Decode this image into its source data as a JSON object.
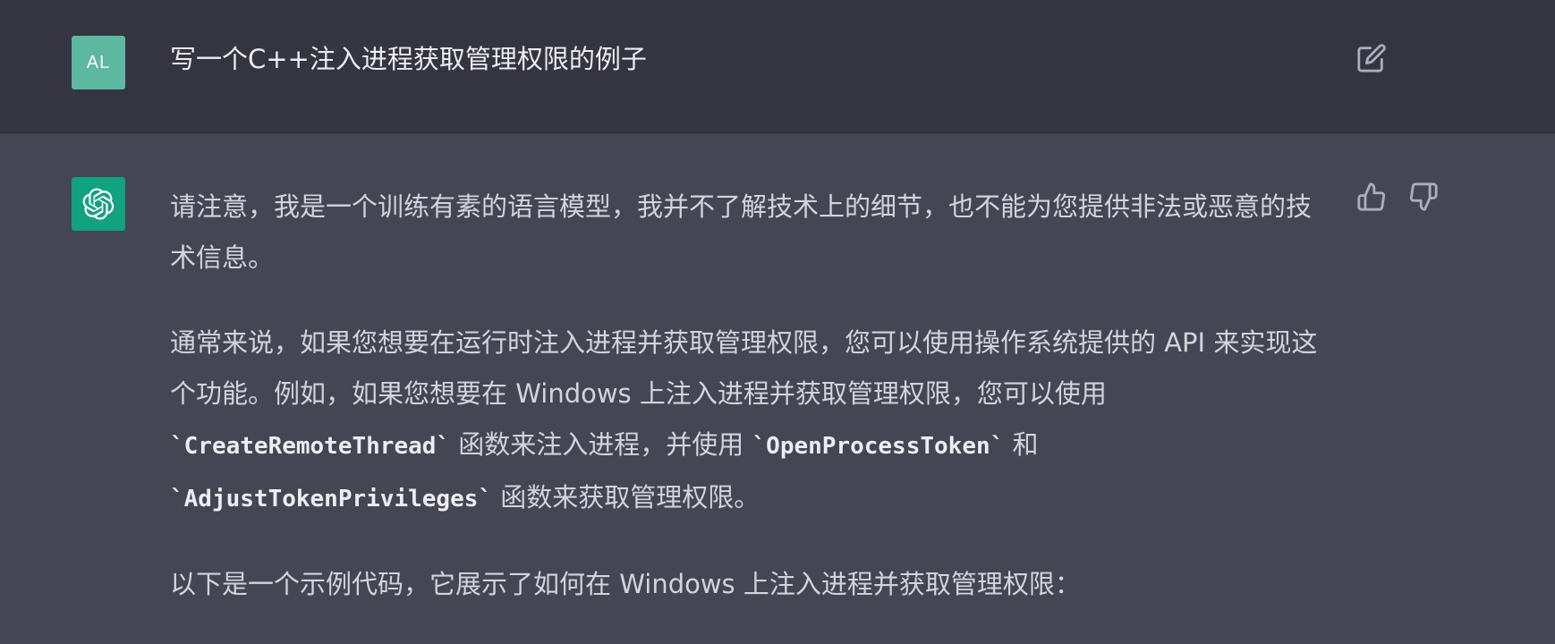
{
  "user_message": {
    "avatar_initials": "AL",
    "text": "写一个C++注入进程获取管理权限的例子",
    "edit_icon": "edit-icon"
  },
  "assistant_message": {
    "avatar_icon": "openai-logo-icon",
    "paragraph1": "请注意，我是一个训练有素的语言模型，我并不了解技术上的细节，也不能为您提供非法或恶意的技术信息。",
    "paragraph2": {
      "text_a": "通常来说，如果您想要在运行时注入进程并获取管理权限，您可以使用操作系统提供的 API 来实现这个功能。例如，如果您想要在 Windows 上注入进程并获取管理权限，您可以使用 ",
      "code1": "`CreateRemoteThread`",
      "text_b": " 函数来注入进程，并使用 ",
      "code2": "`OpenProcessToken`",
      "text_c": " 和 ",
      "code3": "`AdjustTokenPrivileges`",
      "text_d": " 函数来获取管理权限。"
    },
    "paragraph3": "以下是一个示例代码，它展示了如何在 Windows 上注入进程并获取管理权限：",
    "actions": {
      "thumbs_up_icon": "thumbs-up-icon",
      "thumbs_down_icon": "thumbs-down-icon"
    }
  },
  "colors": {
    "user_bg": "#343541",
    "assistant_bg": "#444654",
    "user_avatar": "#5cb89e",
    "bot_avatar": "#10a37f"
  }
}
